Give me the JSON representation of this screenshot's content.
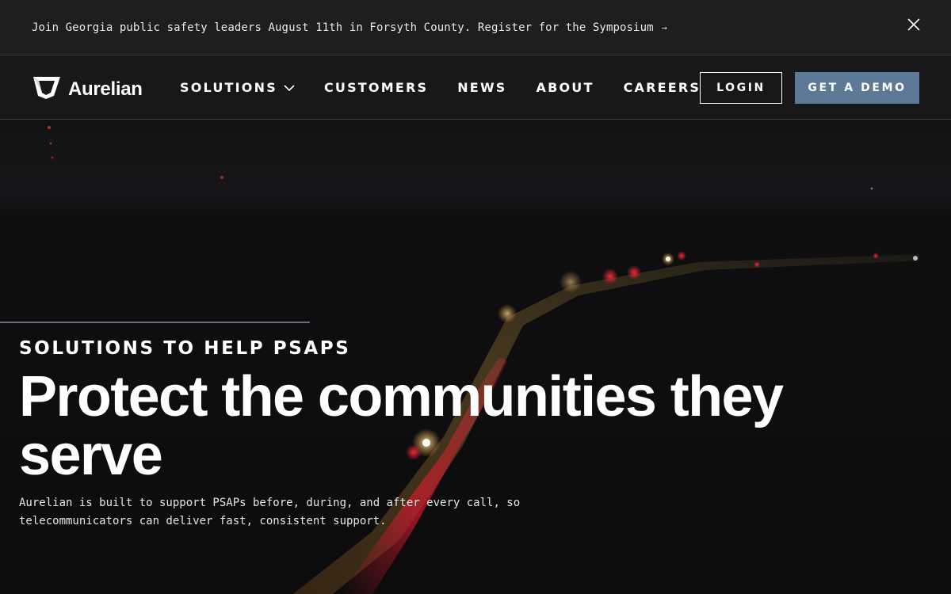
{
  "announcement": {
    "text": "Join Georgia public safety leaders August 11th in Forsyth County. Register for the Symposium",
    "arrow": "→",
    "close_icon": "close-icon"
  },
  "header": {
    "brand": "Aurelian",
    "logo_icon": "aurelian-shield-logo",
    "nav": [
      {
        "label": "SOLUTIONS",
        "has_dropdown": true
      },
      {
        "label": "CUSTOMERS"
      },
      {
        "label": "NEWS"
      },
      {
        "label": "ABOUT"
      },
      {
        "label": "CAREERS"
      }
    ],
    "login_label": "LOGIN",
    "demo_label": "GET A DEMO"
  },
  "hero": {
    "eyebrow": "SOLUTIONS TO HELP PSAPS",
    "headline": "Protect the communities they serve",
    "subtext": "Aurelian is built to support PSAPs before, during, and after every call, so telecommunicators can deliver fast, consistent support.",
    "background": "night aerial view of highway with emergency vehicle lights"
  },
  "colors": {
    "announcement_bg": "#1e1e1e",
    "header_bg": "#18181a",
    "demo_button": "#5c7a97",
    "hero_bg": "#0d0d0f"
  }
}
